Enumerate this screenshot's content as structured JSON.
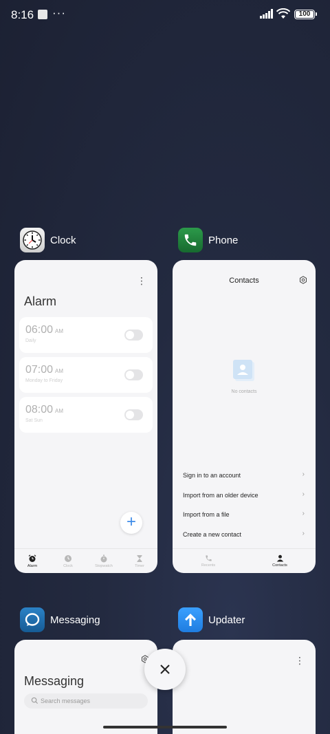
{
  "status": {
    "time": "8:16",
    "dots": "···",
    "battery": "100"
  },
  "clock_app": {
    "name": "Clock",
    "title": "Alarm",
    "alarms": [
      {
        "time": "06:00",
        "ampm": "AM",
        "sub": "Daily"
      },
      {
        "time": "07:00",
        "ampm": "AM",
        "sub": "Monday to Friday"
      },
      {
        "time": "08:00",
        "ampm": "AM",
        "sub": "Sat Sun"
      }
    ],
    "fab": "+",
    "nav": [
      "Alarm",
      "Clock",
      "Stopwatch",
      "Timer"
    ]
  },
  "phone_app": {
    "name": "Phone",
    "title": "Contacts",
    "empty": "No contacts",
    "actions": [
      "Sign in to an account",
      "Import from an older device",
      "Import from a file",
      "Create a new contact"
    ],
    "chevron": "›",
    "nav": [
      "Recents",
      "Contacts"
    ]
  },
  "messaging_app": {
    "name": "Messaging",
    "title": "Messaging",
    "search_placeholder": "Search messages"
  },
  "updater_app": {
    "name": "Updater"
  },
  "menu_glyph": "⋮",
  "colors": {
    "clock_icon_bg": "#e8e8e8",
    "phone_icon_bg": "#1e7d3a",
    "messaging_icon_bg": "#1f6fae",
    "updater_icon_bg": "#2f90f2",
    "accent": "#3f8ce8"
  }
}
